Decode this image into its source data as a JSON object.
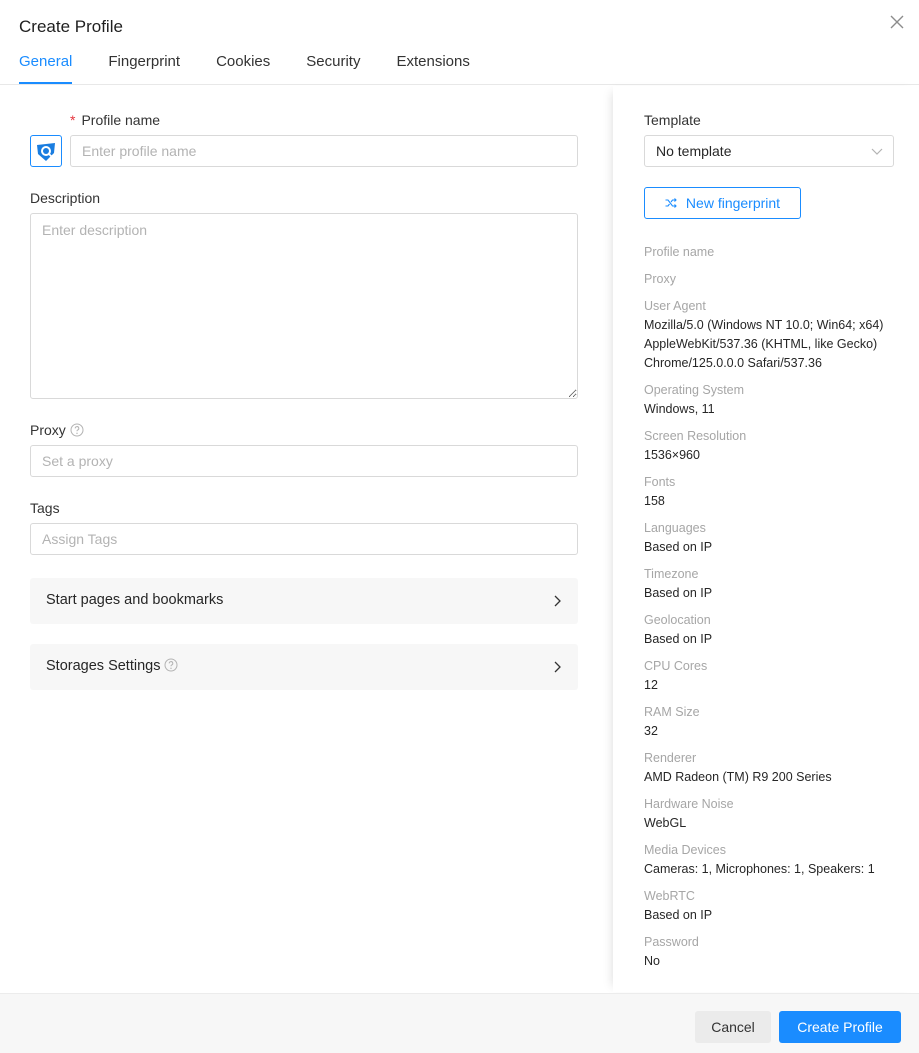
{
  "dialog": {
    "title": "Create Profile"
  },
  "tabs": [
    {
      "label": "General",
      "active": true
    },
    {
      "label": "Fingerprint",
      "active": false
    },
    {
      "label": "Cookies",
      "active": false
    },
    {
      "label": "Security",
      "active": false
    },
    {
      "label": "Extensions",
      "active": false
    }
  ],
  "general": {
    "profile_name": {
      "required_mark": "*",
      "label": "Profile name",
      "placeholder": "Enter profile name",
      "value": ""
    },
    "description": {
      "label": "Description",
      "placeholder": "Enter description",
      "value": ""
    },
    "proxy": {
      "label": "Proxy",
      "placeholder": "Set a proxy",
      "value": ""
    },
    "tags": {
      "label": "Tags",
      "placeholder": "Assign Tags",
      "value": ""
    },
    "panels": [
      {
        "label": "Start pages and bookmarks"
      },
      {
        "label": "Storages Settings"
      }
    ]
  },
  "sidebar": {
    "template_label": "Template",
    "template_value": "No template",
    "new_fingerprint_label": "New fingerprint",
    "info": [
      {
        "key": "Profile name",
        "value": ""
      },
      {
        "key": "Proxy",
        "value": ""
      },
      {
        "key": "User Agent",
        "value": "Mozilla/5.0 (Windows NT 10.0; Win64; x64) AppleWebKit/537.36 (KHTML, like Gecko) Chrome/125.0.0.0 Safari/537.36"
      },
      {
        "key": "Operating System",
        "value": "Windows, 11"
      },
      {
        "key": "Screen Resolution",
        "value": "1536×960"
      },
      {
        "key": "Fonts",
        "value": "158"
      },
      {
        "key": "Languages",
        "value": "Based on IP"
      },
      {
        "key": "Timezone",
        "value": "Based on IP"
      },
      {
        "key": "Geolocation",
        "value": "Based on IP"
      },
      {
        "key": "CPU Cores",
        "value": "12"
      },
      {
        "key": "RAM Size",
        "value": "32"
      },
      {
        "key": "Renderer",
        "value": "AMD Radeon (TM) R9 200 Series"
      },
      {
        "key": "Hardware Noise",
        "value": "WebGL"
      },
      {
        "key": "Media Devices",
        "value": "Cameras: 1, Microphones: 1, Speakers: 1"
      },
      {
        "key": "WebRTC",
        "value": "Based on IP"
      },
      {
        "key": "Password",
        "value": "No"
      }
    ]
  },
  "footer": {
    "cancel_label": "Cancel",
    "create_label": "Create Profile"
  },
  "colors": {
    "accent": "#1a8cff",
    "required": "#e5343d"
  }
}
